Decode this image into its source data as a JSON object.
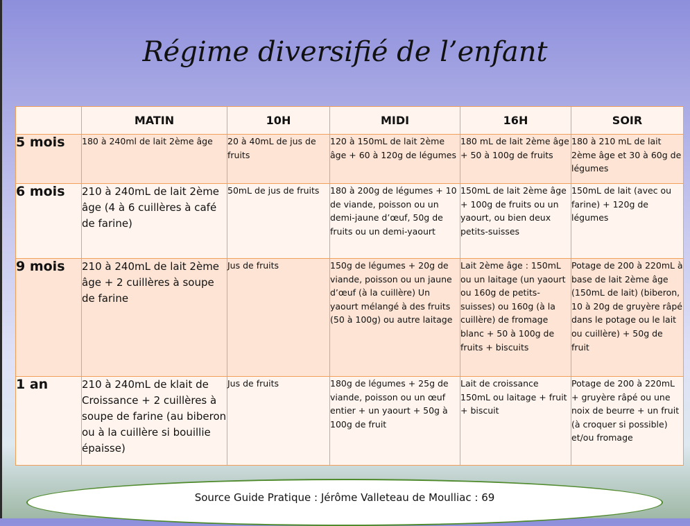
{
  "title": "Régime diversifié de l’enfant",
  "table": {
    "headers": [
      "",
      "MATIN",
      "10H",
      "MIDI",
      "16H",
      "SOIR"
    ],
    "rows": [
      {
        "age": "5 mois",
        "cells": [
          "180 à 240ml de lait 2ème âge",
          "20 à 40mL de jus de fruits",
          "120 à 150mL de lait 2ème âge + 60 à 120g de légumes",
          "180 mL de lait 2ème âge + 50 à 100g de fruits",
          "180 à 210 mL de lait 2ème âge et 30 à 60g de légumes"
        ]
      },
      {
        "age": "6 mois",
        "cells": [
          "210 à 240mL de lait 2ème âge (4 à 6 cuillères à café de farine)",
          "50mL de jus de fruits",
          "180 à 200g de légumes + 10 de viande, poisson ou un demi-jaune d’œuf, 50g de fruits ou un demi-yaourt",
          "150mL de lait 2ème âge + 100g de fruits ou un yaourt, ou bien deux petits-suisses",
          "150mL de lait (avec ou farine) + 120g de légumes"
        ]
      },
      {
        "age": "9 mois",
        "cells": [
          "210 à 240mL de lait 2ème âge + 2 cuillères à soupe de farine",
          "Jus de fruits",
          "150g de légumes + 20g de viande, poisson ou un jaune d’œuf (à la cuillère) Un yaourt mélangé à des fruits (50 à 100g) ou autre laitage",
          "Lait 2ème âge : 150mL ou un laitage (un yaourt ou 160g de petits-suisses) ou 160g (à la cuillère) de fromage blanc + 50 à 100g de fruits + biscuits",
          "Potage de 200 à 220mL à base de lait 2ème âge (150mL de lait) (biberon, 10 à 20g de gruyère râpé dans le potage ou le lait ou cuillère) + 50g de fruit"
        ]
      },
      {
        "age": "1 an",
        "cells": [
          "210 à 240mL de klait de Croissance + 2 cuillères à soupe de farine (au biberon ou à la cuillère si bouillie épaisse)",
          "Jus de fruits",
          "180g de légumes + 25g de viande, poisson ou un œuf entier + un yaourt + 50g à 100g de fruit",
          "Lait de croissance 150mL ou laitage + fruit + biscuit",
          "Potage de 200 à 220mL + gruyère râpé ou une noix de beurre + un fruit (à croquer si possible) et/ou fromage"
        ]
      }
    ]
  },
  "source": "Source Guide Pratique : Jérôme Valleteau de Moulliac : 69",
  "colors": {
    "border": "#f1a05c",
    "row_shade": "#fde4d4",
    "row_light": "#fff5ee",
    "ellipse_border": "#4f8a2d"
  }
}
